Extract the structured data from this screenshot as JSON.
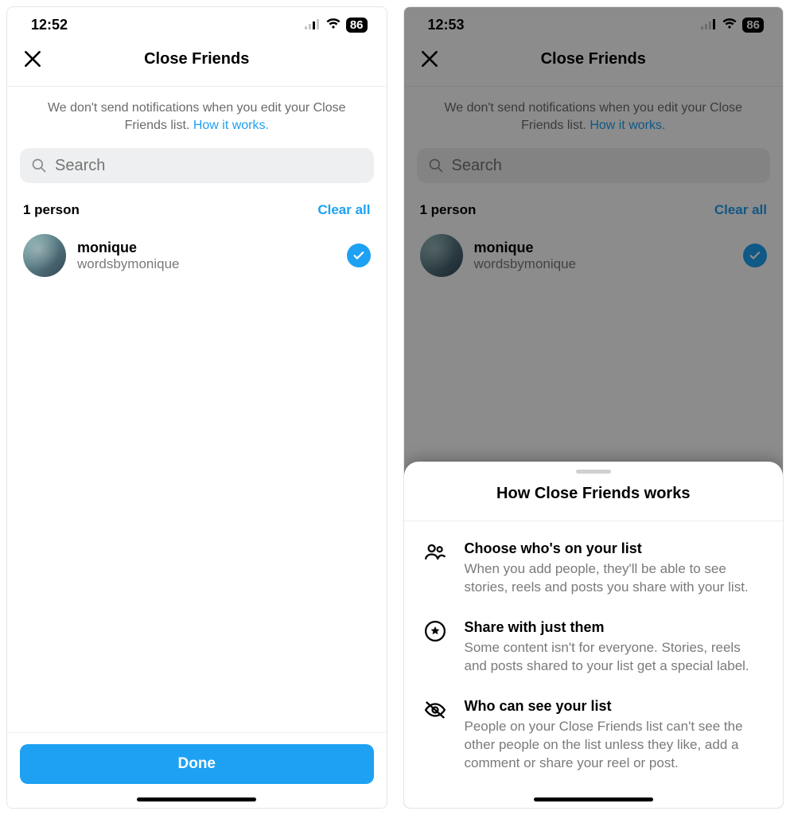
{
  "left": {
    "time": "12:52",
    "battery": "86",
    "title": "Close Friends",
    "notice_text": "We don't send notifications when you edit your Close Friends list. ",
    "notice_link": "How it works.",
    "search_placeholder": "Search",
    "count_label": "1 person",
    "clear_label": "Clear all",
    "friend": {
      "name": "monique",
      "handle": "wordsbymonique"
    },
    "done_label": "Done"
  },
  "right": {
    "time": "12:53",
    "battery": "86",
    "title": "Close Friends",
    "notice_text": "We don't send notifications when you edit your Close Friends list. ",
    "notice_link": "How it works.",
    "search_placeholder": "Search",
    "count_label": "1 person",
    "clear_label": "Clear all",
    "friend": {
      "name": "monique",
      "handle": "wordsbymonique"
    },
    "sheet": {
      "title": "How Close Friends works",
      "items": [
        {
          "title": "Choose who's on your list",
          "body": "When you add people, they'll be able to see stories, reels and posts you share with your list."
        },
        {
          "title": "Share with just them",
          "body": "Some content isn't for everyone. Stories, reels and posts shared to your list get a special label."
        },
        {
          "title": "Who can see your list",
          "body": "People on your Close Friends list can't see the other people on the list unless they like, add a comment or share your reel or post."
        }
      ]
    }
  }
}
